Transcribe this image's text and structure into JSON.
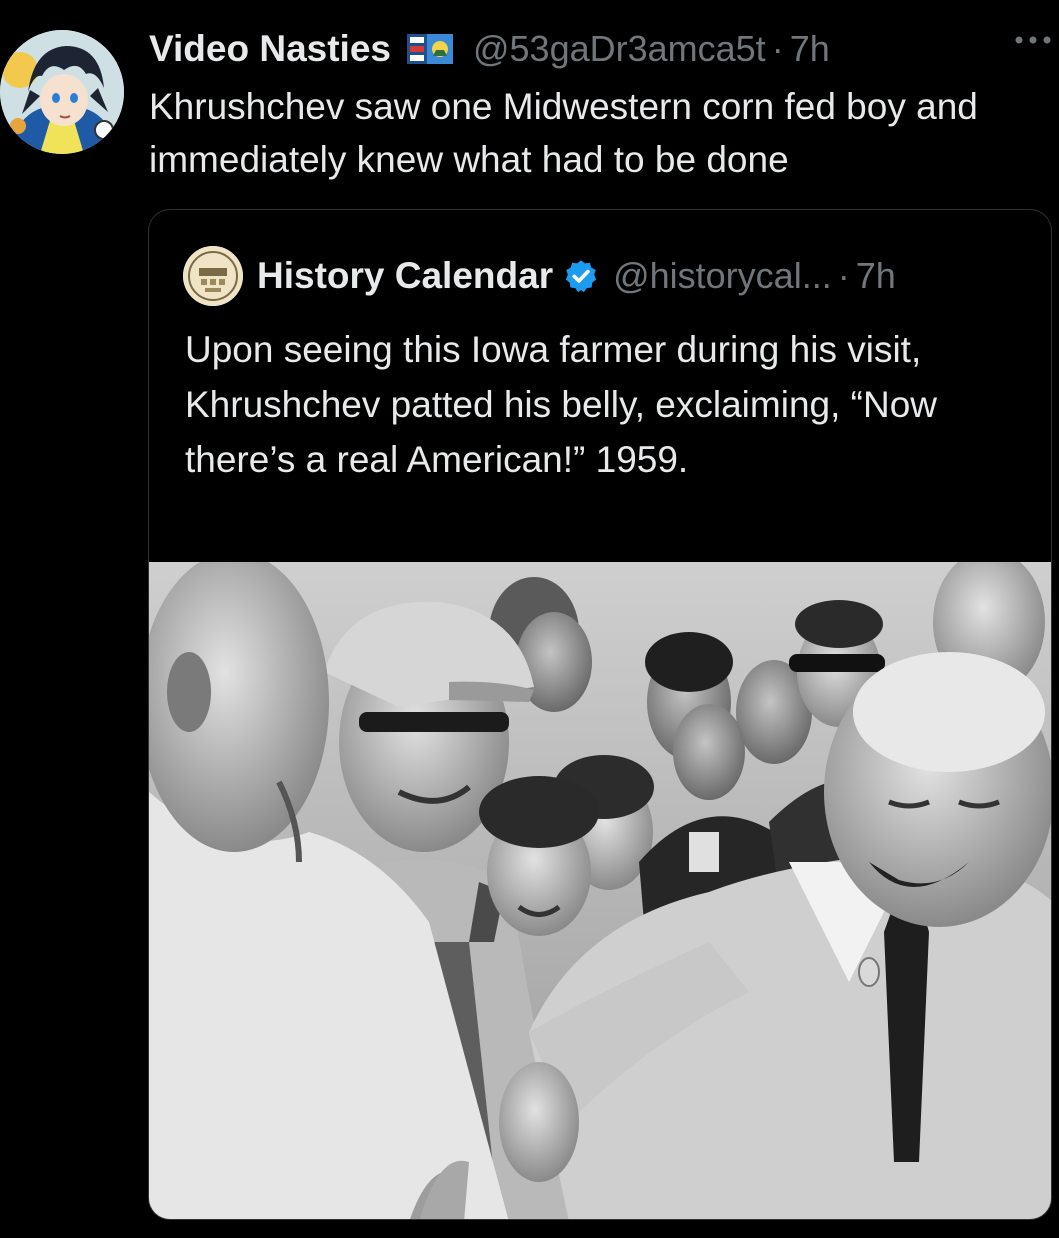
{
  "post": {
    "author": {
      "display_name": "Video Nasties",
      "handle": "@53gaDr3amca5t",
      "separator": "·",
      "time": "7h",
      "flag_icon": "flag-icon",
      "avatar_icon": "anime-avatar-icon"
    },
    "more_icon": "more-horizontal-icon",
    "text": "Khrushchev saw one Midwestern corn fed boy and immediately knew what had to be done"
  },
  "quote": {
    "author": {
      "display_name": "History Calendar",
      "verified_icon": "verified-badge-icon",
      "handle": "@historycal...",
      "separator": "·",
      "time": "7h",
      "avatar_icon": "history-calendar-logo"
    },
    "text": "Upon seeing this Iowa farmer during his visit, Khrushchev patted his belly, exclaiming, “Now there’s a real American!” 1959.",
    "media": {
      "type": "photo",
      "description_icon": "black-and-white-photo"
    }
  },
  "colors": {
    "background": "#000000",
    "text_primary": "#e7e9ea",
    "text_secondary": "#71767b",
    "border": "#2f3336",
    "verified_blue": "#1d9bf0"
  }
}
